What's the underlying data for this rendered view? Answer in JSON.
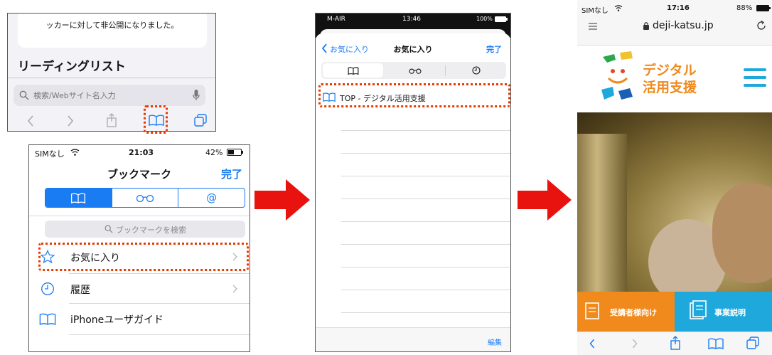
{
  "top_snippet": {
    "private_text": "ッカーに対して非公開になりました。",
    "section_title": "リーディングリスト",
    "search_placeholder": "検索/Webサイト名入力"
  },
  "bookmarks_screen": {
    "status": {
      "carrier": "SIMなし",
      "time": "21:03",
      "battery": "42%"
    },
    "title": "ブックマーク",
    "done": "完了",
    "search_placeholder": "ブックマークを検索",
    "items": [
      {
        "label": "お気に入り",
        "icon": "star-icon"
      },
      {
        "label": "履歴",
        "icon": "clock-icon"
      },
      {
        "label": "iPhoneユーザガイド",
        "icon": "book-icon"
      }
    ]
  },
  "favorites_screen": {
    "status": {
      "carrier": "M-AIR",
      "time": "13:46",
      "battery": "100%"
    },
    "back": "お気に入り",
    "title": "お気に入り",
    "done": "完了",
    "item": "TOP - デジタル活用支援",
    "edit": "編集"
  },
  "site_screen": {
    "status": {
      "carrier": "SIMなし",
      "time": "17:16",
      "battery": "88%"
    },
    "url": "deji-katsu.jp",
    "logo_line1": "デジタル",
    "logo_line2": "活用支援",
    "btn_left": "受講者様向け",
    "btn_right": "事業説明"
  },
  "colors": {
    "accent": "#1a7cf2",
    "highlight": "#e53a00",
    "arrow": "#e8130f",
    "orange": "#f08a1c",
    "teal": "#1ea8dc"
  }
}
